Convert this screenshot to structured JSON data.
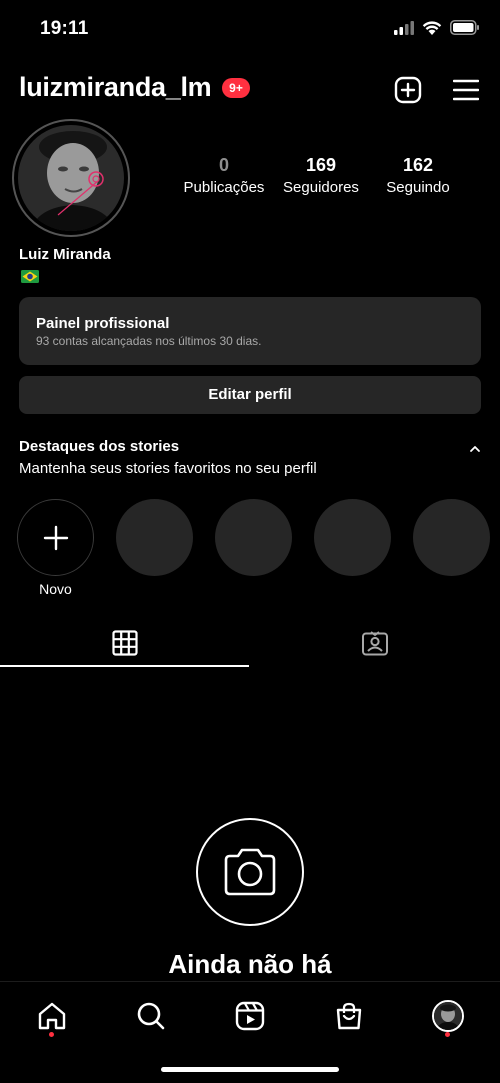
{
  "status_bar": {
    "time": "19:11"
  },
  "header": {
    "username": "luizmiranda_lm",
    "notification_badge": "9+",
    "create_icon": "plus-square-icon",
    "menu_icon": "hamburger-menu-icon"
  },
  "profile": {
    "name": "Luiz Miranda",
    "flag": "brazil-flag-icon",
    "stats": [
      {
        "value": "0",
        "label": "Publicações"
      },
      {
        "value": "169",
        "label": "Seguidores"
      },
      {
        "value": "162",
        "label": "Seguindo"
      }
    ]
  },
  "professional_panel": {
    "title": "Painel profissional",
    "subtitle": "93 contas alcançadas nos últimos 30 dias."
  },
  "edit_profile": {
    "label": "Editar perfil"
  },
  "highlights": {
    "title": "Destaques dos stories",
    "subtitle": "Mantenha seus stories favoritos no seu perfil",
    "new_label": "Novo"
  },
  "tabs": [
    {
      "icon": "grid-icon",
      "active": true
    },
    {
      "icon": "tagged-icon",
      "active": false
    }
  ],
  "empty_state": {
    "text": "Ainda não há"
  },
  "bottom_nav": [
    "home-icon",
    "search-icon",
    "reels-icon",
    "shop-icon",
    "profile-avatar"
  ],
  "colors": {
    "background": "#000000",
    "panel": "#262626",
    "badge": "#ff3040",
    "muted": "#a8a8a8"
  }
}
